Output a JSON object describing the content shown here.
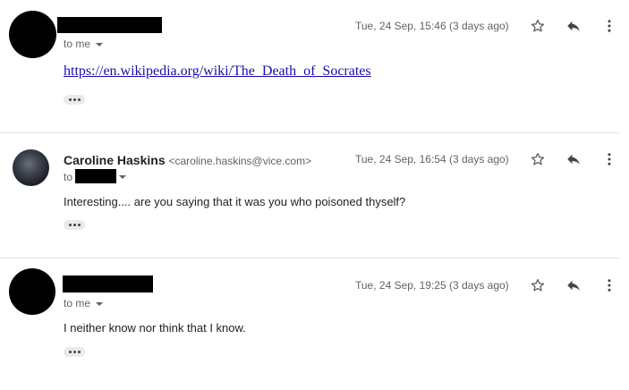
{
  "messages": [
    {
      "sender_redacted": true,
      "to_label": "to me",
      "date": "Tue, 24 Sep, 15:46 (3 days ago)",
      "body_link": "https://en.wikipedia.org/wiki/The_Death_of_Socrates"
    },
    {
      "sender_name": "Caroline Haskins",
      "sender_email": "<caroline.haskins@vice.com>",
      "to_label": "to",
      "date": "Tue, 24 Sep, 16:54 (3 days ago)",
      "body_text": "Interesting.... are you saying that it was you who poisoned thyself?"
    },
    {
      "sender_redacted": true,
      "to_label": "to me",
      "date": "Tue, 24 Sep, 19:25 (3 days ago)",
      "body_text": "I neither know nor think that I know."
    }
  ],
  "icons": {
    "star": "star-icon",
    "reply": "reply-icon",
    "more": "more-vert-icon",
    "trimmed": "ellipsis-icon"
  }
}
